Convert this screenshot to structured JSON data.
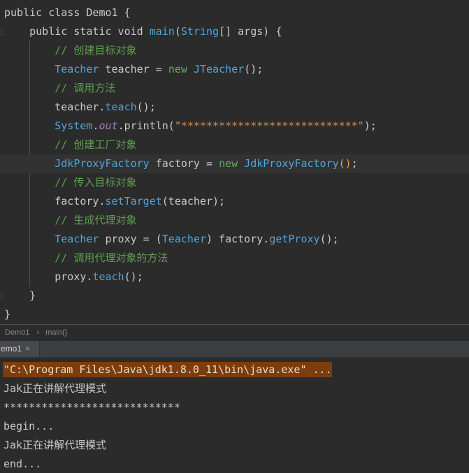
{
  "editor": {
    "lines": [
      {
        "tokens": [
          [
            "public class Demo1 {",
            "#c9c9c9"
          ]
        ]
      },
      {
        "tokens": [
          [
            "    public static void ",
            "#c9c9c9"
          ],
          [
            "main",
            "#4fa6dc"
          ],
          [
            "(",
            "#c9c9c9"
          ],
          [
            "String",
            "#4fa6dc"
          ],
          [
            "[] args) {",
            "#c9c9c9"
          ]
        ]
      },
      {
        "tokens": [
          [
            "        ",
            "#c9c9c9"
          ],
          [
            "// 创建目标对象",
            "#5e9f50"
          ]
        ]
      },
      {
        "tokens": [
          [
            "        ",
            "#c9c9c9"
          ],
          [
            "Teacher",
            "#4fa6dc"
          ],
          [
            " teacher = ",
            "#c9c9c9"
          ],
          [
            "new",
            "#5fae5a"
          ],
          [
            " ",
            "#c9c9c9"
          ],
          [
            "JTeacher",
            "#4fa6dc"
          ],
          [
            "();",
            "#c9c9c9"
          ]
        ]
      },
      {
        "tokens": [
          [
            "        ",
            "#c9c9c9"
          ],
          [
            "// 调用方法",
            "#5e9f50"
          ]
        ]
      },
      {
        "tokens": [
          [
            "        teacher.",
            "#c9c9c9"
          ],
          [
            "teach",
            "#5a9fd4"
          ],
          [
            "();",
            "#c9c9c9"
          ]
        ]
      },
      {
        "tokens": [
          [
            "        ",
            "#c9c9c9"
          ],
          [
            "System",
            "#4fa6dc"
          ],
          [
            ".",
            "#c9c9c9"
          ],
          [
            "out",
            "#a77bc2",
            true
          ],
          [
            ".println(",
            "#c9c9c9"
          ],
          [
            "\"****************************\"",
            "#d0884c"
          ],
          [
            ");",
            "#c9c9c9"
          ]
        ]
      },
      {
        "tokens": [
          [
            "        ",
            "#c9c9c9"
          ],
          [
            "// 创建工厂对象",
            "#5e9f50"
          ]
        ]
      },
      {
        "current": true,
        "tokens": [
          [
            "        ",
            "#c9c9c9"
          ],
          [
            "JdkProxyFactory",
            "#4fa6dc"
          ],
          [
            " factory = ",
            "#c9c9c9"
          ],
          [
            "new",
            "#5fae5a"
          ],
          [
            " ",
            "#c9c9c9"
          ],
          [
            "JdkProxyFactory",
            "#4fa6dc"
          ],
          [
            "()",
            "#e0a040"
          ],
          [
            ";",
            "#c9c9c9"
          ]
        ]
      },
      {
        "tokens": [
          [
            "        ",
            "#c9c9c9"
          ],
          [
            "// 传入目标对象",
            "#5e9f50"
          ]
        ]
      },
      {
        "tokens": [
          [
            "        factory.",
            "#c9c9c9"
          ],
          [
            "setTarget",
            "#5a9fd4"
          ],
          [
            "(teacher);",
            "#c9c9c9"
          ]
        ]
      },
      {
        "tokens": [
          [
            "        ",
            "#c9c9c9"
          ],
          [
            "// 生成代理对象",
            "#5e9f50"
          ]
        ]
      },
      {
        "tokens": [
          [
            "        ",
            "#c9c9c9"
          ],
          [
            "Teacher",
            "#4fa6dc"
          ],
          [
            " proxy = (",
            "#c9c9c9"
          ],
          [
            "Teacher",
            "#4fa6dc"
          ],
          [
            ") factory.",
            "#c9c9c9"
          ],
          [
            "getProxy",
            "#5a9fd4"
          ],
          [
            "();",
            "#c9c9c9"
          ]
        ]
      },
      {
        "tokens": [
          [
            "        ",
            "#c9c9c9"
          ],
          [
            "// 调用代理对象的方法",
            "#5e9f50"
          ]
        ]
      },
      {
        "tokens": [
          [
            "        proxy.",
            "#c9c9c9"
          ],
          [
            "teach",
            "#5a9fd4"
          ],
          [
            "();",
            "#c9c9c9"
          ]
        ]
      },
      {
        "tokens": [
          [
            "    }",
            "#c9c9c9"
          ]
        ]
      },
      {
        "tokens": [
          [
            "}",
            "#c9c9c9"
          ]
        ]
      }
    ]
  },
  "breadcrumb": {
    "items": [
      "Demo1",
      "main()"
    ],
    "separator": "›"
  },
  "run_tabs": [
    {
      "label": "emo1",
      "close": "×"
    }
  ],
  "console": {
    "highlight_color": "#7c3d0e",
    "lines": [
      {
        "text": "\"C:\\Program Files\\Java\\jdk1.8.0_11\\bin\\java.exe\" ...",
        "highlight": true
      },
      {
        "text": "Jak正在讲解代理模式"
      },
      {
        "text": "****************************"
      },
      {
        "text": "begin..."
      },
      {
        "text": "Jak正在讲解代理模式"
      },
      {
        "text": "end..."
      }
    ]
  }
}
